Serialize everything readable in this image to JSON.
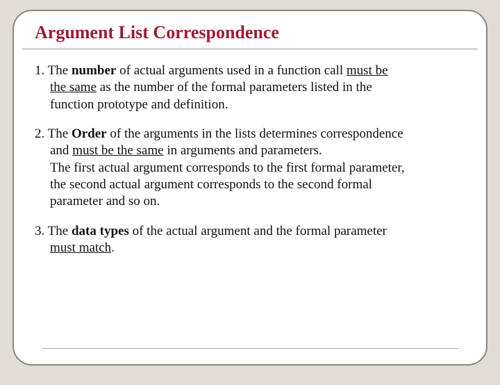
{
  "title": "Argument List Correspondence",
  "item1": {
    "num": "1. ",
    "t1": "The ",
    "t2": "number",
    "t3": " of actual arguments used in a function call ",
    "t4": "must be",
    "l2a": "the same",
    "l2b": " as the number of the formal parameters listed in the",
    "l3": "function prototype and definition."
  },
  "item2": {
    "num": "2. ",
    "t1": "The ",
    "t2": "Order",
    "t3": " of the arguments in the lists determines correspondence",
    "l2a": "and ",
    "l2b": "must be the same",
    "l2c": " in arguments and parameters.",
    "l3": "The first actual argument corresponds to the first formal parameter,",
    "l4": "the second actual argument corresponds to the second formal",
    "l5": "parameter and so on."
  },
  "item3": {
    "num": "3. ",
    "t1": "The ",
    "t2": "data types",
    "t3": " of the actual argument and the formal parameter",
    "l2": "must match",
    "l2b": "."
  }
}
